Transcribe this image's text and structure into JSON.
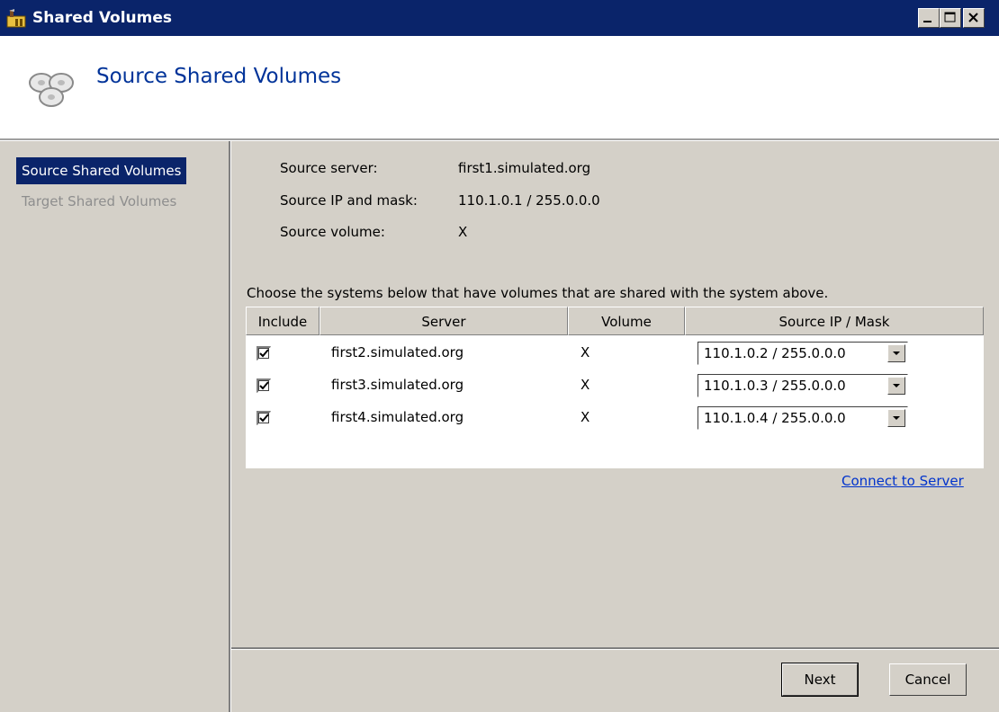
{
  "window": {
    "title": "Shared Volumes"
  },
  "header": {
    "title": "Source Shared Volumes"
  },
  "sidebar": {
    "items": [
      {
        "label": "Source Shared Volumes",
        "state": "active"
      },
      {
        "label": "Target Shared Volumes",
        "state": "disabled"
      }
    ]
  },
  "source": {
    "server_label": "Source server:",
    "server_value": "first1.simulated.org",
    "ip_label": "Source IP and mask:",
    "ip_value": "110.1.0.1 / 255.0.0.0",
    "volume_label": "Source volume:",
    "volume_value": "X"
  },
  "instructions": "Choose the systems below that have volumes that are shared with the system above.",
  "table": {
    "columns": [
      "Include",
      "Server",
      "Volume",
      "Source IP / Mask"
    ],
    "rows": [
      {
        "include": true,
        "server": "first2.simulated.org",
        "volume": "X",
        "ip_mask": "110.1.0.2 / 255.0.0.0"
      },
      {
        "include": true,
        "server": "first3.simulated.org",
        "volume": "X",
        "ip_mask": "110.1.0.3 / 255.0.0.0"
      },
      {
        "include": true,
        "server": "first4.simulated.org",
        "volume": "X",
        "ip_mask": "110.1.0.4 / 255.0.0.0"
      }
    ]
  },
  "connect_link": "Connect to Server",
  "buttons": {
    "next": "Next",
    "cancel": "Cancel"
  },
  "colors": {
    "titlebar": "#0a246a",
    "header_title": "#003399",
    "link": "#0033cc",
    "dialog_bg": "#d4d0c8"
  }
}
